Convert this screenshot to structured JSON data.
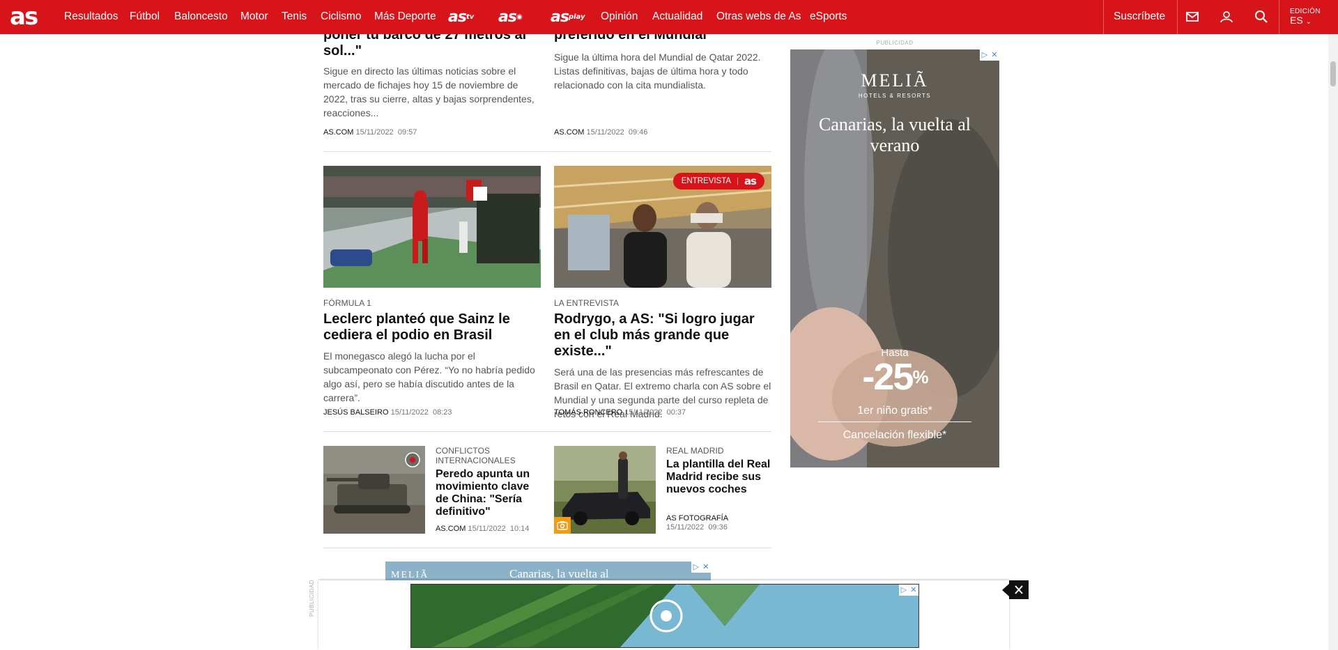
{
  "nav": {
    "logo": "as",
    "items": [
      "Resultados",
      "Fútbol",
      "Baloncesto",
      "Motor",
      "Tenis",
      "Ciclismo",
      "Más Deporte"
    ],
    "brand_logos": [
      {
        "text": "as",
        "suffix": "tv",
        "icon": "as-tv-logo"
      },
      {
        "text": "as",
        "suffix": "◉",
        "icon": "as-foto-logo"
      },
      {
        "text": "as",
        "suffix": "play",
        "icon": "as-audio-logo"
      }
    ],
    "items2": [
      "Opinión",
      "Actualidad",
      "Otras webs de As",
      "eSports"
    ],
    "subscribe": "Suscríbete",
    "edition_label": "EDICIÓN",
    "edition_value": "ES"
  },
  "top_row": {
    "left": {
      "headline_tail": "poner tu barco de 27 metros al sol...\"",
      "summary": "Sigue en directo las últimas noticias sobre el mercado de fichajes hoy 15 de noviembre de 2022, tras su cierre, altas y bajas sorprendentes, reacciones...",
      "author": "AS.COM",
      "date": "15/11/2022",
      "time": "09:57"
    },
    "right": {
      "headline_tail": "preferido en el Mundial",
      "summary": "Sigue la última hora del Mundial de Qatar 2022. Listas definitivas, bajas de última hora y todo relacionado con la cita mundialista.",
      "author": "AS.COM",
      "date": "15/11/2022",
      "time": "09:46"
    }
  },
  "mid_row": {
    "left": {
      "kicker": "FÓRMULA 1",
      "headline": "Leclerc planteó que Sainz le cediera el podio en Brasil",
      "summary": "El monegasco alegó la lucha por el subcampeonato con Pérez. “Yo no habría pedido algo así, pero se había discutido antes de la carrera”.",
      "author": "JESÚS BALSEIRO",
      "date": "15/11/2022",
      "time": "08:23"
    },
    "right": {
      "badge": "ENTREVISTA",
      "badge_logo": "as",
      "kicker": "LA ENTREVISTA",
      "headline": "Rodrygo, a AS: \"Si logro jugar en el club más grande que existe...\"",
      "summary": "Será una de las presencias más refrescantes de Brasil en Qatar. El extremo charla con AS sobre el Mundial y una segunda parte del curso repleta de retos con el Real Madrid.",
      "author": "TOMÁS RONCERO",
      "date": "15/11/2022",
      "time": "00:37"
    }
  },
  "bottom_row": {
    "left": {
      "kicker": "CONFLICTOS INTERNACIONALES",
      "headline": "Peredo apunta un movimiento clave de China: \"Sería definitivo\"",
      "author": "AS.COM",
      "date": "15/11/2022",
      "time": "10:14"
    },
    "right": {
      "kicker": "REAL MADRID",
      "headline": "La plantilla del Real Madrid recibe sus nuevos coches",
      "author": "AS FOTOGRAFÍA",
      "date": "15/11/2022",
      "time": "09:36"
    }
  },
  "side_ad": {
    "label": "PUBLICIDAD",
    "brand": "MELIÃ",
    "brand_sub": "HOTELS & RESORTS",
    "title": "Canarias, la vuelta al verano",
    "hasta": "Hasta",
    "discount": "-25",
    "percent": "%",
    "line1": "1er niño gratis*",
    "line2": "Cancelación flexible*"
  },
  "inline_ad": {
    "label": "PUBLICIDAD",
    "brand": "MELIÃ",
    "title": "Canarias, la vuelta al"
  },
  "colors": {
    "brand_red": "#d7141a",
    "kicker_grey": "#555555"
  }
}
